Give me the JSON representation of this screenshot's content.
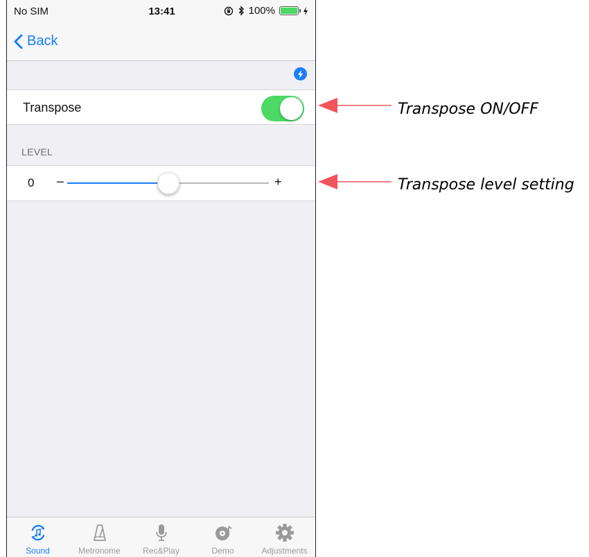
{
  "status_bar": {
    "carrier": "No SIM",
    "time": "13:41",
    "battery_percent": "100%"
  },
  "nav": {
    "back_label": "Back"
  },
  "transpose_row": {
    "label": "Transpose",
    "toggle_on": true,
    "accent_color": "#4cd964"
  },
  "level_section": {
    "header": "LEVEL",
    "value": "0",
    "minus": "–",
    "plus": "+",
    "slider_fraction": 0.5
  },
  "tabs": [
    {
      "label": "Sound",
      "icon": "sound-icon",
      "active": true
    },
    {
      "label": "Metronome",
      "icon": "metronome-icon",
      "active": false
    },
    {
      "label": "Rec&Play",
      "icon": "microphone-icon",
      "active": false
    },
    {
      "label": "Demo",
      "icon": "demo-disc-icon",
      "active": false
    },
    {
      "label": "Adjustments",
      "icon": "gear-icon",
      "active": false
    }
  ],
  "annotations": {
    "transpose_toggle": "Transpose ON/OFF",
    "level_setting": "Transpose level setting"
  },
  "colors": {
    "ios_blue": "#157efb",
    "toggle_green": "#4cd964",
    "arrow_red": "#f2545b"
  }
}
